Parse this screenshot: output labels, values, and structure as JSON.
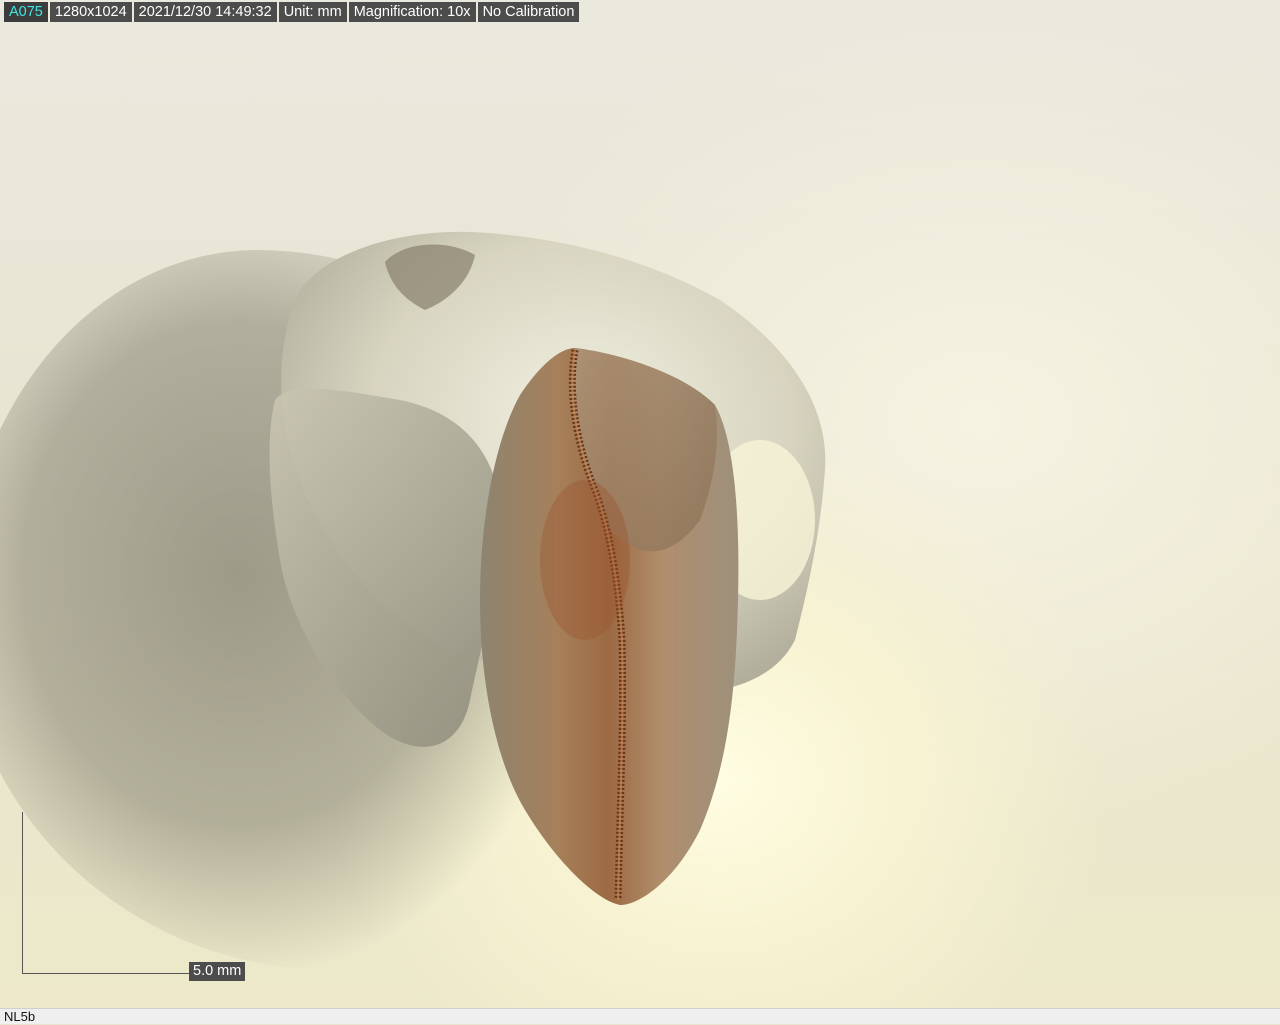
{
  "overlay": {
    "camera_id": "A075",
    "resolution": "1280x1024",
    "datetime": "2021/12/30 14:49:32",
    "unit": "Unit: mm",
    "magnification": "Magnification:  10x",
    "calibration": "No Calibration"
  },
  "scale_bar": {
    "label": "5.0 mm"
  },
  "status_bar": {
    "sample_name": "NL5b"
  },
  "specimen": {
    "description_icon": "fossil-tooth-photo",
    "colors": {
      "matrix": "#d9d6c2",
      "tooth_enamel": "#a0805c",
      "serration": "#7a3f1e",
      "background": "#ece8d6"
    }
  }
}
